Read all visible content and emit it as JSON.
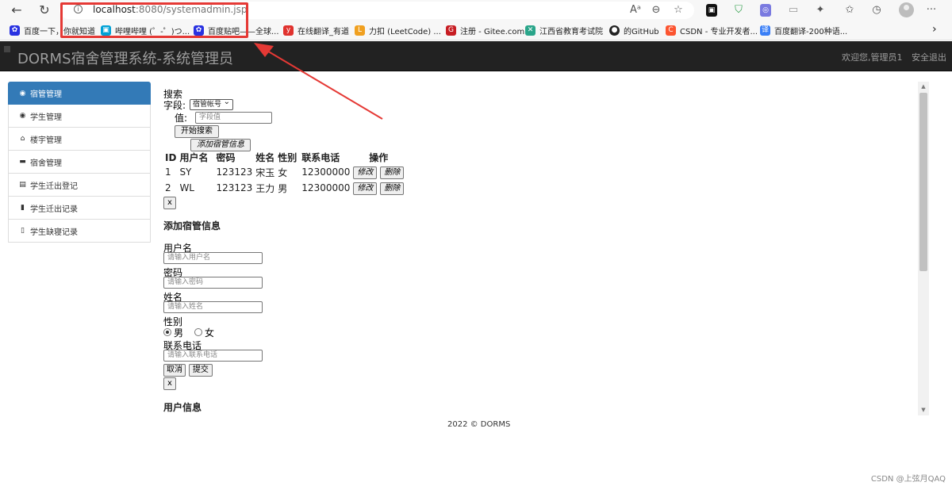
{
  "browser": {
    "url_host": "localhost",
    "url_rest": ":8080/systemadmin.jsp",
    "bookmarks": [
      {
        "label": "百度一下，你就知道",
        "icon": "baidu-paw-icon",
        "color": "#2932e1"
      },
      {
        "label": "哔哩哔哩 (゜-゜)つ...",
        "icon": "bilibili-icon",
        "color": "#00a1d6"
      },
      {
        "label": "百度贴吧——全球...",
        "icon": "baidu-paw-icon",
        "color": "#2932e1"
      },
      {
        "label": "在线翻译_有道",
        "icon": "youdao-icon",
        "color": "#e0322e"
      },
      {
        "label": "力扣 (LeetCode) ...",
        "icon": "leetcode-icon",
        "color": "#f0a020"
      },
      {
        "label": "注册 - Gitee.com",
        "icon": "gitee-icon",
        "color": "#c71d23"
      },
      {
        "label": "江西省教育考试院",
        "icon": "jiangxi-icon",
        "color": "#2aa58a"
      },
      {
        "label": "的GitHub",
        "icon": "github-icon",
        "color": "#222222"
      },
      {
        "label": "CSDN - 专业开发者...",
        "icon": "csdn-icon",
        "color": "#fc5531"
      },
      {
        "label": "百度翻译-200种语...",
        "icon": "baidu-translate-icon",
        "color": "#3a7ff6"
      }
    ]
  },
  "header": {
    "brand": "DORMS宿舍管理系统-系统管理员",
    "welcome": "欢迎您,管理员1",
    "logout": "安全退出"
  },
  "sidebar": {
    "items": [
      {
        "label": "宿管管理",
        "icon": "user-circle-icon",
        "active": true
      },
      {
        "label": "学生管理",
        "icon": "user-circle-icon"
      },
      {
        "label": "楼宇管理",
        "icon": "home-icon"
      },
      {
        "label": "宿舍管理",
        "icon": "bed-icon"
      },
      {
        "label": "学生迁出登记",
        "icon": "id-card-icon"
      },
      {
        "label": "学生迁出记录",
        "icon": "bookmark-filled-icon"
      },
      {
        "label": "学生缺寝记录",
        "icon": "bookmark-outline-icon"
      }
    ]
  },
  "search": {
    "title": "搜索",
    "field_label": "字段:",
    "field_select": "宿管帐号",
    "value_label": "值:",
    "value_placeholder": "字段值",
    "start_button": "开始搜索",
    "add_button": "添加宿管信息"
  },
  "table": {
    "columns": [
      "ID",
      "用户名",
      "密码",
      "姓名",
      "性别",
      "联系电话",
      "操作"
    ],
    "rows": [
      {
        "id": "1",
        "username": "SY",
        "password": "123123",
        "name": "宋玉",
        "gender": "女",
        "phone": "12300000"
      },
      {
        "id": "2",
        "username": "WL",
        "password": "123123",
        "name": "王力",
        "gender": "男",
        "phone": "12300000"
      }
    ],
    "edit_label": "修改",
    "delete_label": "删除",
    "close_label": "x"
  },
  "add_form": {
    "title": "添加宿管信息",
    "username_label": "用户名",
    "username_placeholder": "请输入用户名",
    "password_label": "密码",
    "password_placeholder": "请输入密码",
    "name_label": "姓名",
    "name_placeholder": "请输入姓名",
    "gender_label": "性别",
    "gender_male": "男",
    "gender_female": "女",
    "gender_selected": "男",
    "phone_label": "联系电话",
    "phone_placeholder": "请输入联系电话",
    "cancel_button": "取消",
    "submit_button": "提交",
    "close_label": "x"
  },
  "user_info": {
    "title": "用户信息"
  },
  "footer": {
    "text": "2022 © DORMS"
  },
  "watermark": "CSDN @上弦月QAQ",
  "annotation": {
    "highlight_color": "#e53935"
  }
}
